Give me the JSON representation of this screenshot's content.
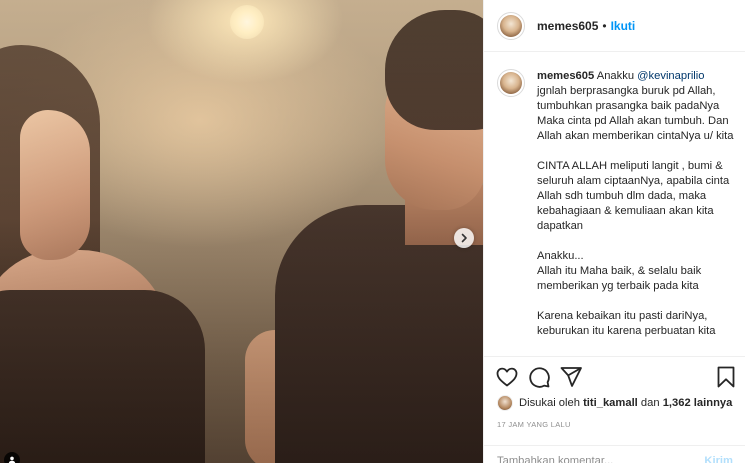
{
  "post": {
    "username": "memes605",
    "separator": "•",
    "follow_label": "Ikuti"
  },
  "caption": {
    "username": "memes605",
    "intro": "Anakku",
    "mention": "@kevinaprilio",
    "body": "jgnlah berprasangka buruk pd Allah, tumbuhkan prasangka baik padaNya Maka cinta pd Allah akan tumbuh. Dan Allah akan memberikan cintaNya u/ kita\n\nCINTA ALLAH meliputi langit , bumi & seluruh alam ciptaanNya, apabila cinta Allah sdh tumbuh dlm dada, maka kebahagiaan & kemuliaan akan kita dapatkan\n\nAnakku...\nAllah itu Maha baik, & selalu baik memberikan yg terbaik pada kita\n\nKarena kebaikan itu pasti dariNya, keburukan itu karena perbuatan kita"
  },
  "likes": {
    "prefix": "Disukai oleh",
    "liker": "titi_kamall",
    "joiner": "dan",
    "others": "1,362 lainnya"
  },
  "timestamp": "17 JAM YANG LALU",
  "comment_input": {
    "placeholder": "Tambahkan komentar...",
    "post_label": "Kirim"
  },
  "icons": {
    "like": "heart-icon",
    "comment": "comment-icon",
    "share": "share-icon",
    "save": "bookmark-icon",
    "next": "chevron-right-icon",
    "tags": "user-tag-icon"
  },
  "colors": {
    "accent": "#0095f6",
    "mention": "#00376b",
    "muted": "#8e8e8e",
    "post_disabled": "#b2dffc"
  }
}
